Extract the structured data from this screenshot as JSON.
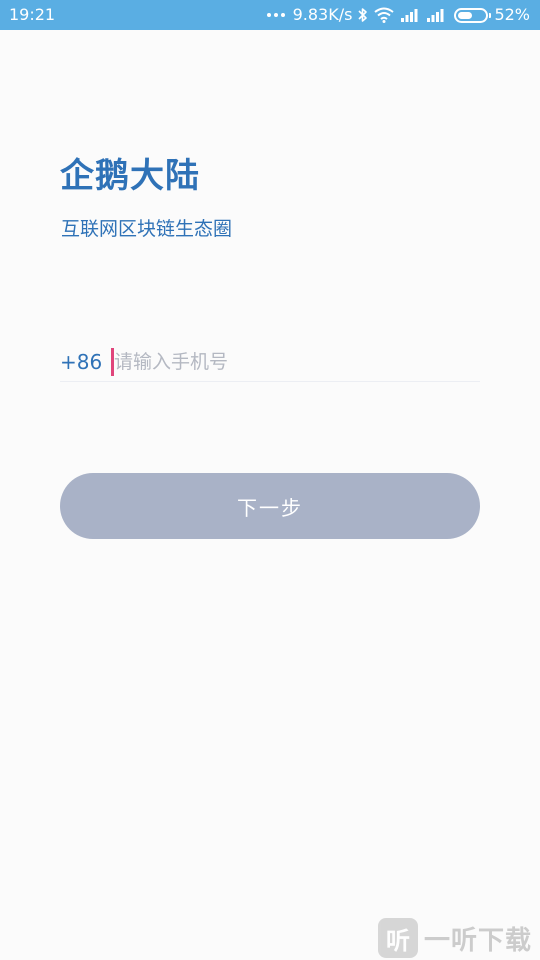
{
  "status_bar": {
    "time": "19:21",
    "net_speed": "9.83K/s",
    "battery_percent": "52%",
    "battery_level": 0.52,
    "icons": [
      "dots-icon",
      "bluetooth-icon",
      "wifi-icon",
      "signal-icon",
      "signal-icon",
      "battery-icon"
    ]
  },
  "header": {
    "title": "企鹅大陆",
    "subtitle": "互联网区块链生态圈"
  },
  "phone": {
    "country_code": "+86",
    "value": "",
    "placeholder": "请输入手机号"
  },
  "next_button": {
    "label": "下一步"
  },
  "watermark": {
    "logo_glyph": "听",
    "text": "一听下载"
  },
  "colors": {
    "status_bar_bg": "#5aaee3",
    "accent": "#2f72b7",
    "button_bg": "#a9b2c7",
    "cursor": "#e0457b",
    "page_bg": "#fbfbfb"
  }
}
